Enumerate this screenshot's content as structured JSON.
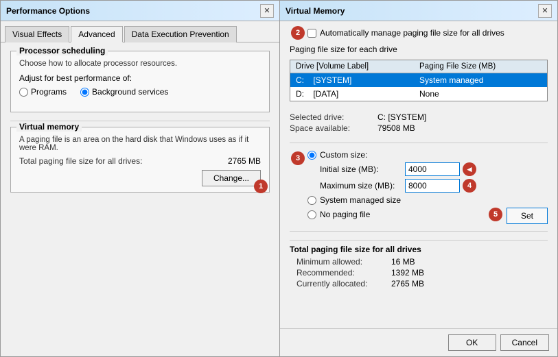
{
  "performance_options": {
    "title": "Performance Options",
    "close_btn": "✕",
    "tabs": [
      {
        "label": "Visual Effects",
        "active": false
      },
      {
        "label": "Advanced",
        "active": true
      },
      {
        "label": "Data Execution Prevention",
        "active": false
      }
    ],
    "processor_scheduling": {
      "title": "Processor scheduling",
      "desc": "Choose how to allocate processor resources.",
      "adjust_label": "Adjust for best performance of:",
      "options": [
        {
          "label": "Programs",
          "selected": false
        },
        {
          "label": "Background services",
          "selected": true
        }
      ]
    },
    "virtual_memory": {
      "group_label": "Virtual memory",
      "desc": "A paging file is an area on the hard disk that Windows uses as if it were RAM.",
      "total_label": "Total paging file size for all drives:",
      "total_value": "2765 MB",
      "change_btn": "Change...",
      "badge": "1"
    }
  },
  "virtual_memory": {
    "title": "Virtual Memory",
    "close_btn": "✕",
    "badge_2": "2",
    "auto_manage_label": "Automatically manage paging file size for all drives",
    "auto_manage_checked": false,
    "paging_section_label": "Paging file size for each drive",
    "drive_table": {
      "headers": [
        "Drive  [Volume Label]",
        "Paging File Size (MB)"
      ],
      "rows": [
        {
          "drive": "C:",
          "label": "[SYSTEM]",
          "size": "System managed",
          "selected": true
        },
        {
          "drive": "D:",
          "label": "[DATA]",
          "size": "None",
          "selected": false
        }
      ]
    },
    "selected_drive": {
      "label": "Selected drive:",
      "value": "C: [SYSTEM]",
      "space_label": "Space available:",
      "space_value": "79508 MB"
    },
    "badge_3": "3",
    "custom_size_label": "Custom size:",
    "initial_size_label": "Initial size (MB):",
    "initial_size_value": "4000",
    "max_size_label": "Maximum size (MB):",
    "max_size_value": "8000",
    "badge_4": "4",
    "system_managed_label": "System managed size",
    "no_paging_label": "No paging file",
    "badge_5": "5",
    "set_btn": "Set",
    "total_section": {
      "title": "Total paging file size for all drives",
      "minimum_label": "Minimum allowed:",
      "minimum_value": "16 MB",
      "recommended_label": "Recommended:",
      "recommended_value": "1392 MB",
      "current_label": "Currently allocated:",
      "current_value": "2765 MB"
    },
    "ok_btn": "OK",
    "cancel_btn": "Cancel"
  }
}
